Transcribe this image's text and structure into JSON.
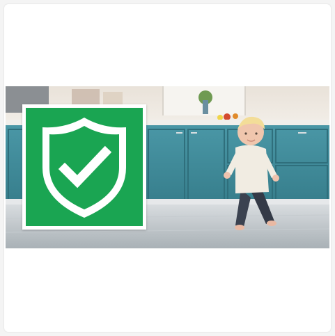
{
  "image": {
    "alt": "",
    "badge_icon": "shield-check-icon",
    "scene": "kitchen-child-photo"
  },
  "colors": {
    "badge_green": "#1aa552",
    "cabinet_teal": "#3f8a99",
    "floor": "#b8bfc4",
    "wall": "#ece7e0"
  }
}
